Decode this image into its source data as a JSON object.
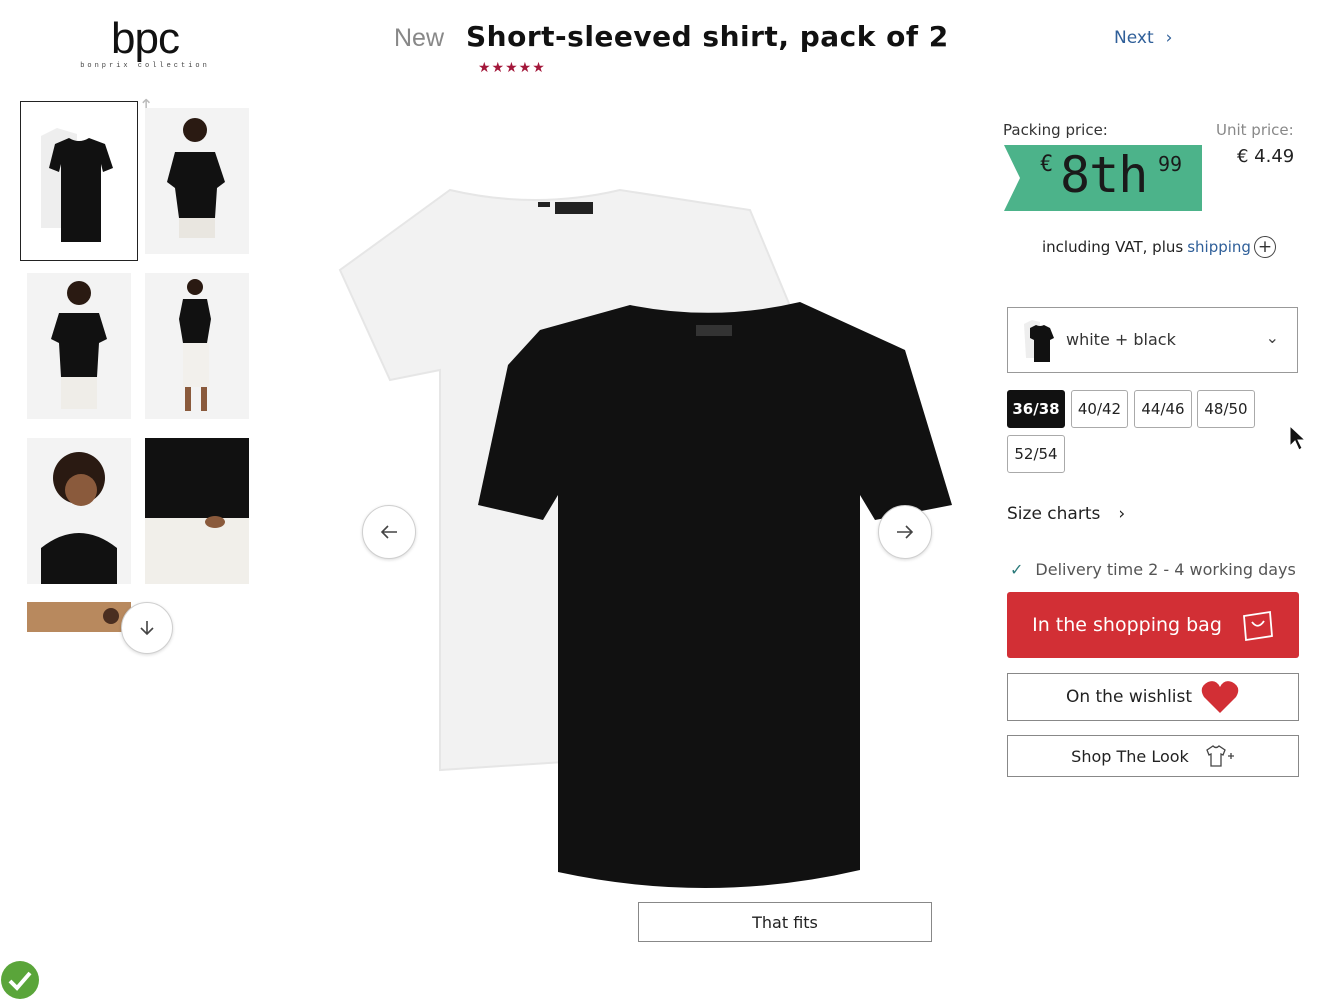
{
  "brand": {
    "logo_text": "bpc",
    "logo_sub": "bonprix collection"
  },
  "product": {
    "new_label": "New",
    "title": "Short-sleeved shirt, pack of 2",
    "stars": "★★★★★",
    "rating_color": "#a3173a"
  },
  "nav": {
    "next_label": "Next",
    "next_icon": "chevron-right-icon"
  },
  "price": {
    "packing_label": "Packing price:",
    "currency": "€",
    "main": "8th",
    "cents": "99",
    "tag_color": "#4cb38a",
    "unit_label": "Unit price:",
    "unit_value": "€ 4.49",
    "vat_text": "including VAT, plus",
    "shipping_link": "shipping"
  },
  "color_select": {
    "value": "white + black",
    "icon": "chevron-down-icon"
  },
  "sizes": [
    {
      "label": "36/38",
      "selected": true
    },
    {
      "label": "40/42",
      "selected": false
    },
    {
      "label": "44/46",
      "selected": false
    },
    {
      "label": "48/50",
      "selected": false
    },
    {
      "label": "52/54",
      "selected": false
    }
  ],
  "size_charts_label": "Size charts",
  "delivery_text": "Delivery time 2 - 4 working days",
  "buttons": {
    "bag": "In the shopping bag",
    "bag_color": "#d22f35",
    "wishlist": "On the wishlist",
    "shop_look": "Shop The Look",
    "fit": "That fits"
  },
  "icons": {
    "prev": "arrow-left-icon",
    "next": "arrow-right-icon",
    "thumb_down": "arrow-down-icon",
    "thumb_up": "arrow-up-icon",
    "bag": "shopping-bag-icon",
    "heart": "heart-icon",
    "shirt_plus": "shirt-plus-icon",
    "plus": "plus-circle-icon",
    "check": "check-icon"
  }
}
